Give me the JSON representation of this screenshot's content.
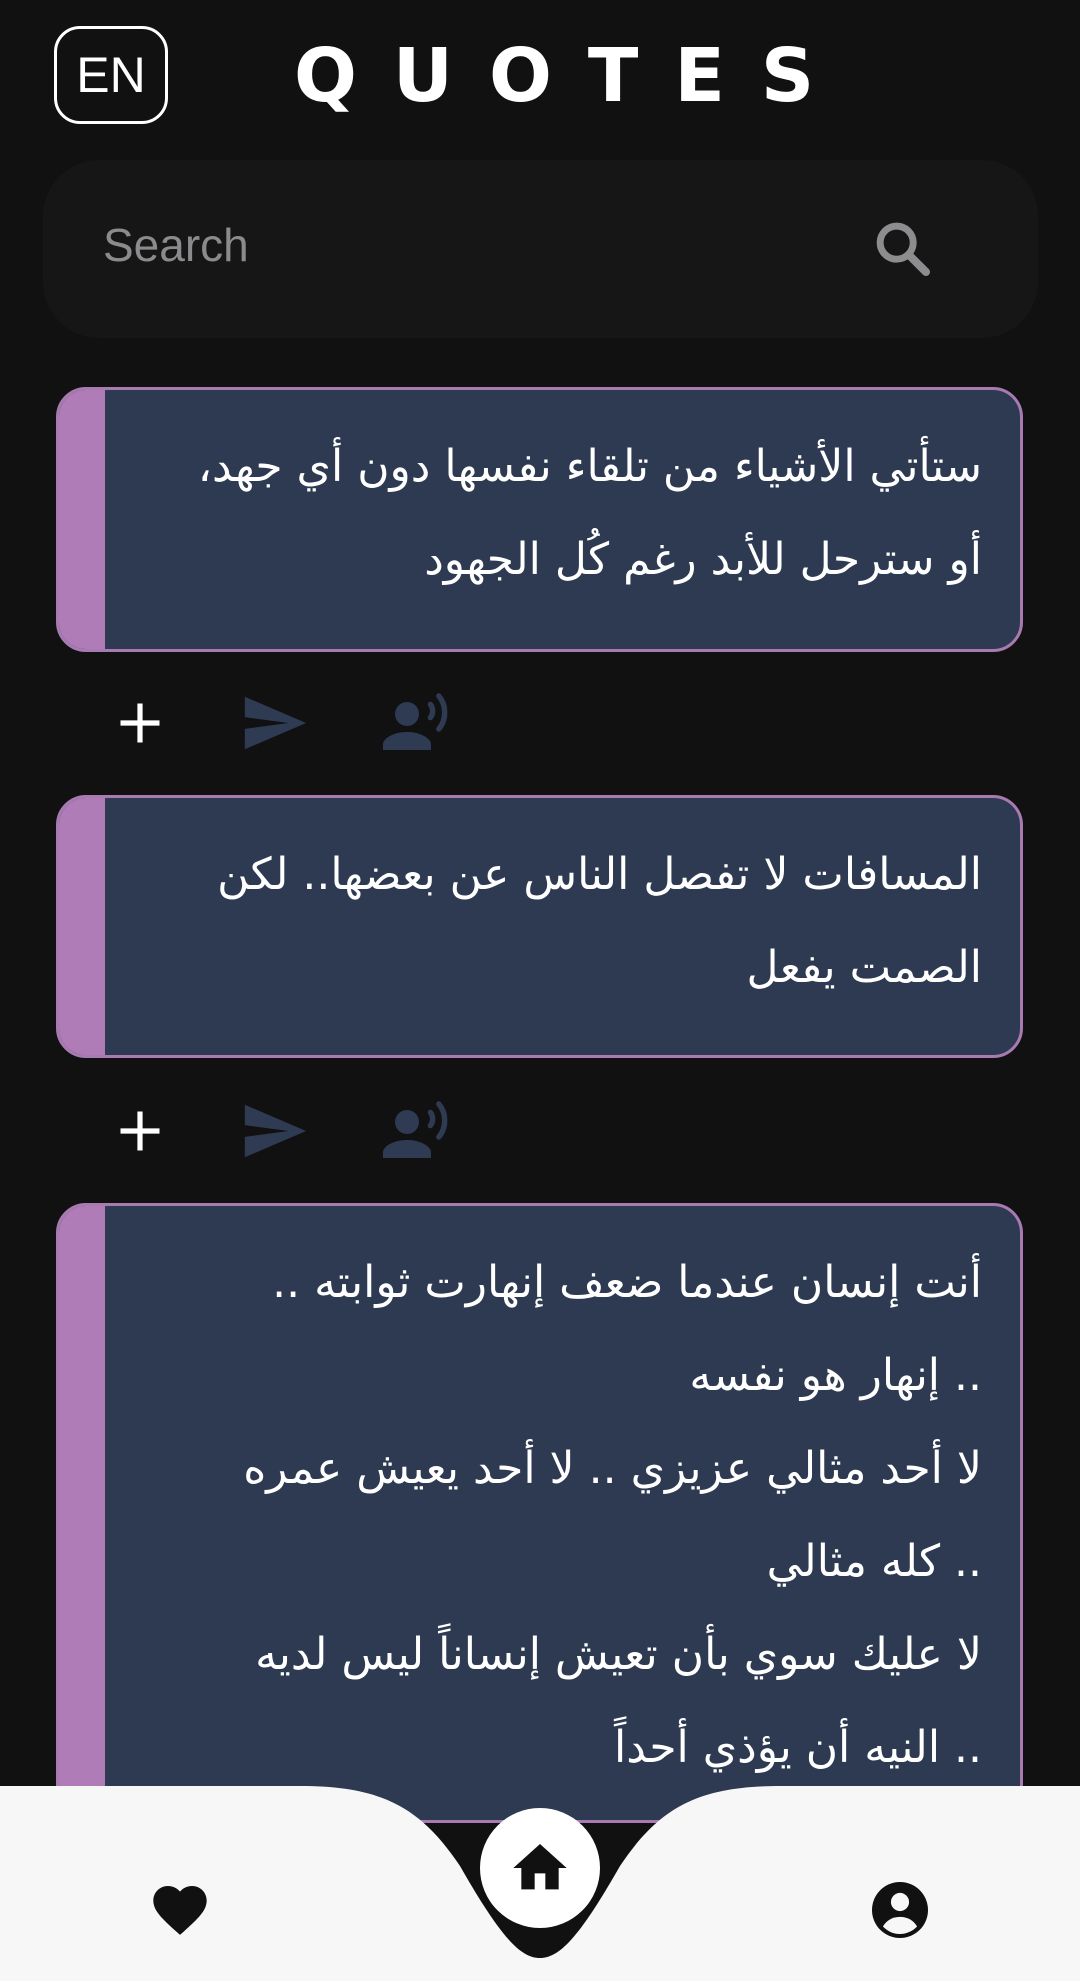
{
  "header": {
    "lang_label": "EN",
    "title": "QUOTES"
  },
  "search": {
    "placeholder": "Search",
    "icon": "search-icon"
  },
  "quotes": [
    {
      "text": "ستأتي الأشياء من تلقاء نفسها دون أي جهد،\nأو سترحل للأبد رغم كُل الجهود",
      "actions": [
        "plus-icon",
        "send-icon",
        "voice-icon"
      ]
    },
    {
      "text": "المسافات لا تفصل الناس عن بعضها.. لكن\nالصمت يفعل",
      "actions": [
        "plus-icon",
        "send-icon",
        "voice-icon"
      ]
    },
    {
      "text": "أنت إنسان عندما ضعف إنهارت ثوابته ..\n.. إنهار هو نفسه\nلا أحد مثالي عزيزي .. لا أحد يعيش عمره\n.. كله مثالي\nلا عليك سوي بأن تعيش إنساناً ليس لديه\n.. النيه أن يؤذي أحداً"
    }
  ],
  "nav": {
    "items": [
      "heart-icon",
      "home-icon",
      "profile-icon"
    ],
    "active": "home"
  },
  "colors": {
    "background": "#111112",
    "card": "#2d3a52",
    "accent": "#b07cb8",
    "icon_muted": "#2f3b52",
    "nav_bar": "#f7f7f7"
  }
}
